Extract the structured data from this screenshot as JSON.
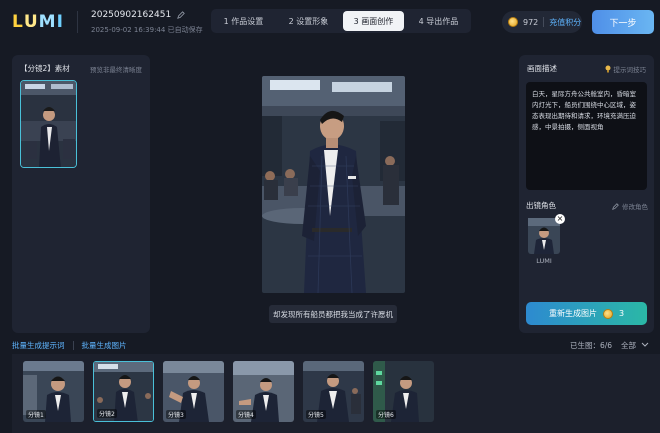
{
  "app": {
    "logo_text": "LUMI",
    "project_name": "20250902162451",
    "project_meta": "2025-09-02 16:39:44 已自动保存"
  },
  "steps": [
    {
      "label": "1 作品设置",
      "active": false
    },
    {
      "label": "2 设置形象",
      "active": false
    },
    {
      "label": "3 画面创作",
      "active": true
    },
    {
      "label": "4 导出作品",
      "active": false
    }
  ],
  "credits": {
    "amount": "972",
    "recharge_label": "充值积分"
  },
  "next_label": "下一步",
  "left_panel": {
    "title": "【分镜2】素材",
    "hint": "预览非最终清晰度"
  },
  "center": {
    "caption": "却发现所有船员都把我当成了许愿机"
  },
  "right_panel": {
    "desc_title": "画面描述",
    "desc_tip": "提示词技巧",
    "desc_text": "白天，星际方舟公共舱室内，昏暗室内灯光下，船员们围绕中心区域，姿态表现出期待和请求，环境充满压迫感，中景拍摄，侧面视角",
    "role_title": "出镜角色",
    "role_edit": "修改角色",
    "role_name": "LUMI",
    "regen_label": "重新生成图片",
    "regen_cost": "3"
  },
  "bottom": {
    "batch_prompt": "批量生成提示词",
    "batch_image": "批量生成图片",
    "generated": "已生图：6/6",
    "filter": "全部"
  },
  "shots": [
    {
      "label": "分镜1"
    },
    {
      "label": "分镜2"
    },
    {
      "label": "分镜3"
    },
    {
      "label": "分镜4"
    },
    {
      "label": "分镜5"
    },
    {
      "label": "分镜6"
    }
  ],
  "colors": {
    "accent": "#4ac0d8",
    "link": "#5fb5ff",
    "background": "#161a24",
    "panel": "#1f2432"
  }
}
